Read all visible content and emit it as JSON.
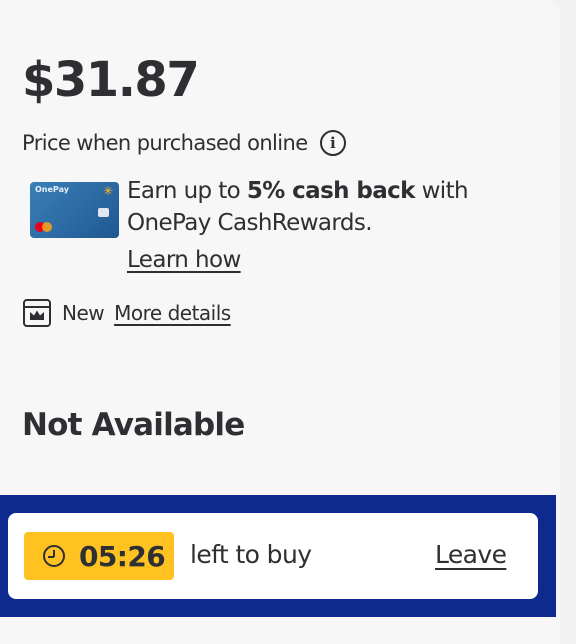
{
  "product": {
    "price": "$31.87",
    "price_note": "Price when purchased online",
    "info_icon": "info-circle-icon"
  },
  "promo": {
    "card_brand": "OnePay",
    "text_before": "Earn up to ",
    "text_bold": "5% cash back",
    "text_after": " with OnePay CashRewards.",
    "learn_link": "Learn how"
  },
  "condition": {
    "icon": "store-crown-icon",
    "label": "New",
    "details_link": "More details"
  },
  "availability": {
    "status": "Not Available"
  },
  "timer": {
    "icon": "clock-icon",
    "value": "05:26",
    "label": "left to buy",
    "leave_link": "Leave"
  },
  "colors": {
    "accent_yellow": "#ffc220",
    "bar_blue": "#0e2a8f",
    "text": "#2e2f32"
  }
}
